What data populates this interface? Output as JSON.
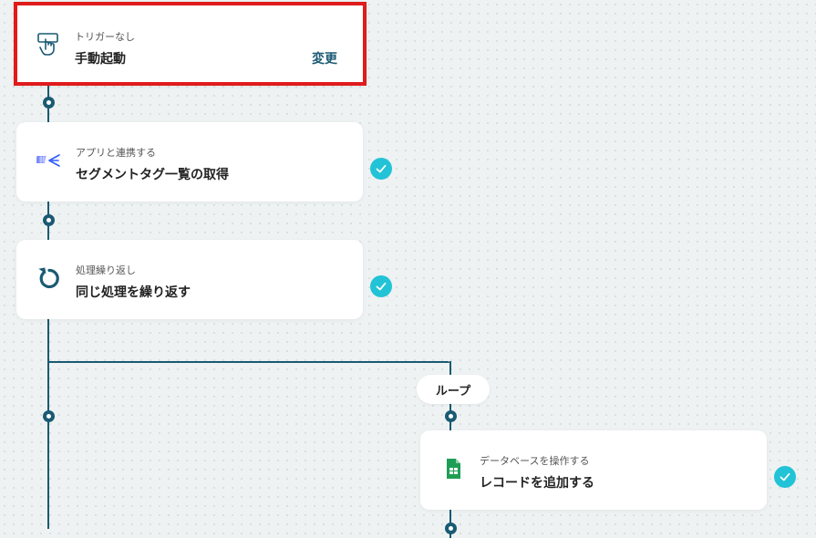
{
  "trigger": {
    "subtitle": "トリガーなし",
    "title": "手動起動",
    "change_label": "変更",
    "icon": "hand-pointer-icon",
    "highlight_color": "#e01b1b"
  },
  "steps": [
    {
      "subtitle": "アプリと連携する",
      "title": "セグメントタグ一覧の取得",
      "icon": "app-integration-icon",
      "status": "completed"
    },
    {
      "subtitle": "処理繰り返し",
      "title": "同じ処理を繰り返す",
      "icon": "loop-arrow-icon",
      "status": "completed"
    },
    {
      "subtitle": "データベースを操作する",
      "title": "レコードを追加する",
      "icon": "google-sheets-icon",
      "status": "completed"
    }
  ],
  "loop_label": "ループ",
  "colors": {
    "connector": "#1a5a73",
    "check": "#22c3d6",
    "sheets_green": "#1e9e54"
  }
}
